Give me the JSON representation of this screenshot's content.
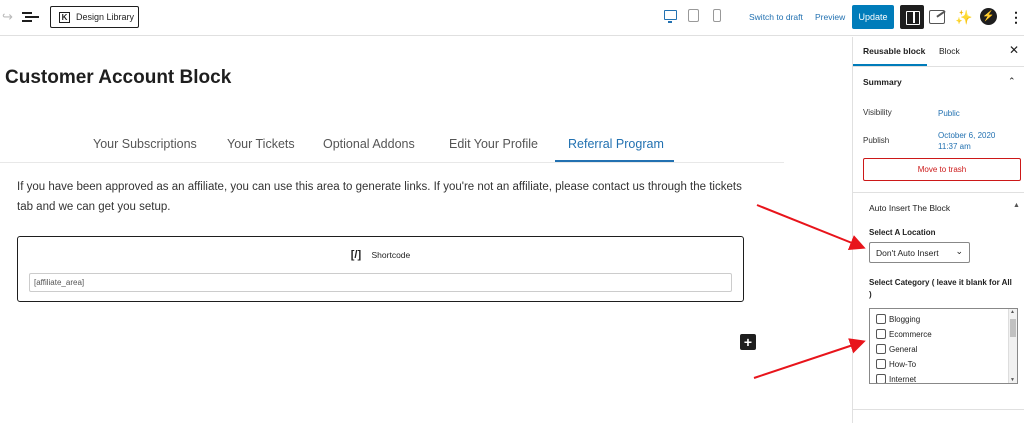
{
  "toolbar": {
    "design_library_label": "Design Library",
    "switch_to_draft": "Switch to draft",
    "preview": "Preview",
    "update": "Update"
  },
  "editor": {
    "title": "Customer Account Block",
    "tabs": [
      {
        "label": "Your Subscriptions"
      },
      {
        "label": "Your Tickets"
      },
      {
        "label": "Optional Addons"
      },
      {
        "label": "Edit Your Profile"
      },
      {
        "label": "Referral Program",
        "active": true
      }
    ],
    "paragraph": "If you have been approved as an affiliate, you can use this area to generate links. If you're not an affiliate, please contact us through the tickets tab and we can get you setup.",
    "shortcode_block": {
      "icon_text": "[/]",
      "label": "Shortcode",
      "value": "[affiliate_area]"
    }
  },
  "sidebar": {
    "tabs": [
      {
        "label": "Reusable block",
        "active": true
      },
      {
        "label": "Block"
      }
    ],
    "summary": {
      "heading": "Summary",
      "visibility_label": "Visibility",
      "visibility_value": "Public",
      "publish_label": "Publish",
      "publish_value_line1": "October 6, 2020",
      "publish_value_line2": "11:37 am",
      "trash_label": "Move to trash"
    },
    "auto_insert": {
      "heading": "Auto Insert The Block",
      "location_label": "Select A Location",
      "location_value": "Don't Auto Insert",
      "category_label_line1": "Select Category ( leave it blank for All",
      "category_label_line2": ")",
      "categories": [
        "Blogging",
        "Ecommerce",
        "General",
        "How-To",
        "Internet"
      ]
    }
  },
  "colors": {
    "accent": "#007cba",
    "link": "#2271b1",
    "danger": "#cc1818",
    "annotation_arrow": "#e8141b"
  }
}
